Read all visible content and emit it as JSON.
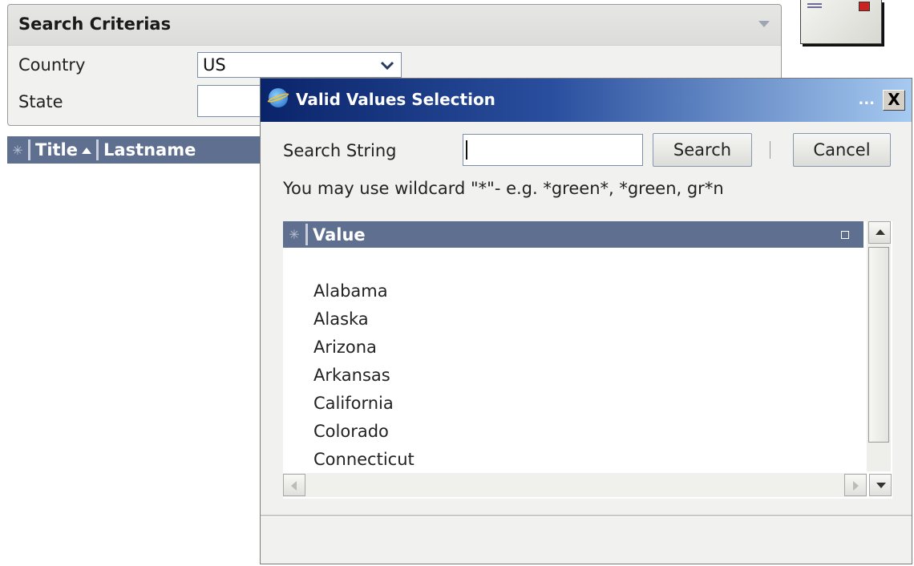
{
  "criteria": {
    "title": "Search Criterias",
    "country_label": "Country",
    "country_value": "US",
    "state_label": "State",
    "state_value": ""
  },
  "results": {
    "columns": [
      "Title",
      "Lastname"
    ]
  },
  "dialog": {
    "title": "Valid Values Selection",
    "title_extra": "...",
    "close_label": "X",
    "search_label": "Search String",
    "search_value": "",
    "search_button": "Search",
    "cancel_button": "Cancel",
    "hint": "You may use wildcard \"*\"- e.g. *green*, *green, gr*n",
    "list_header": "Value",
    "values": [
      "Alabama",
      "Alaska",
      "Arizona",
      "Arkansas",
      "California",
      "Colorado",
      "Connecticut"
    ]
  },
  "colors": {
    "titlebar_start": "#0a246a",
    "titlebar_end": "#a6caf0",
    "header_bar": "#5f6f8f"
  },
  "icons": [
    "collapse-arrow-icon",
    "dropdown-arrow-icon",
    "select-all-icon",
    "sort-ascending-icon",
    "envelope-icon",
    "app-icon",
    "close-icon",
    "column-menu-icon",
    "scroll-up-icon",
    "scroll-down-icon",
    "scroll-left-icon",
    "scroll-right-icon"
  ]
}
